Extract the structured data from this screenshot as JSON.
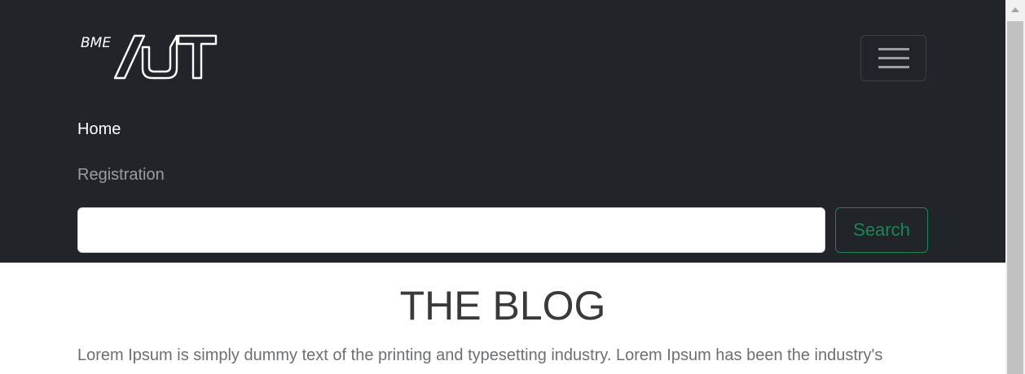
{
  "navbar": {
    "logo_text": "BME AUT",
    "toggler_icon": "hamburger-icon",
    "links": [
      {
        "label": "Home",
        "active": true
      },
      {
        "label": "Registration",
        "active": false
      }
    ],
    "search": {
      "value": "",
      "placeholder": "",
      "button_label": "Search"
    },
    "colors": {
      "background": "#212529",
      "active_link": "#ffffff",
      "inactive_link": "#9a9da1",
      "search_accent": "#198754"
    }
  },
  "main": {
    "title": "THE BLOG",
    "intro": "Lorem Ipsum is simply dummy text of the printing and typesetting industry. Lorem Ipsum has been the industry's"
  }
}
